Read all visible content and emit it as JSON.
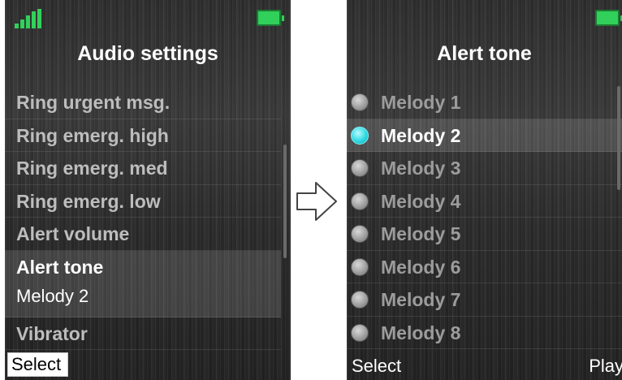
{
  "left_screen": {
    "title": "Audio settings",
    "items": [
      {
        "label": "Ring urgent msg."
      },
      {
        "label": "Ring emerg. high"
      },
      {
        "label": "Ring emerg. med"
      },
      {
        "label": "Ring emerg. low"
      },
      {
        "label": "Alert volume"
      },
      {
        "label": "Alert tone",
        "value": "Melody 2",
        "selected": true
      },
      {
        "label": "Vibrator"
      }
    ],
    "softkey_left": "Select"
  },
  "right_screen": {
    "title": "Alert tone",
    "options": [
      {
        "label": "Melody 1",
        "selected": false
      },
      {
        "label": "Melody 2",
        "selected": true
      },
      {
        "label": "Melody 3",
        "selected": false
      },
      {
        "label": "Melody 4",
        "selected": false
      },
      {
        "label": "Melody 5",
        "selected": false
      },
      {
        "label": "Melody 6",
        "selected": false
      },
      {
        "label": "Melody 7",
        "selected": false
      },
      {
        "label": "Melody 8",
        "selected": false
      }
    ],
    "softkey_left": "Select",
    "softkey_right": "Play"
  },
  "icons": {
    "signal": "signal-strength-icon",
    "battery": "battery-icon",
    "arrow": "arrow-right-icon"
  },
  "colors": {
    "battery": "#31d05a",
    "signal": "#31d05a",
    "radio_selected": "#2fd9e2"
  }
}
